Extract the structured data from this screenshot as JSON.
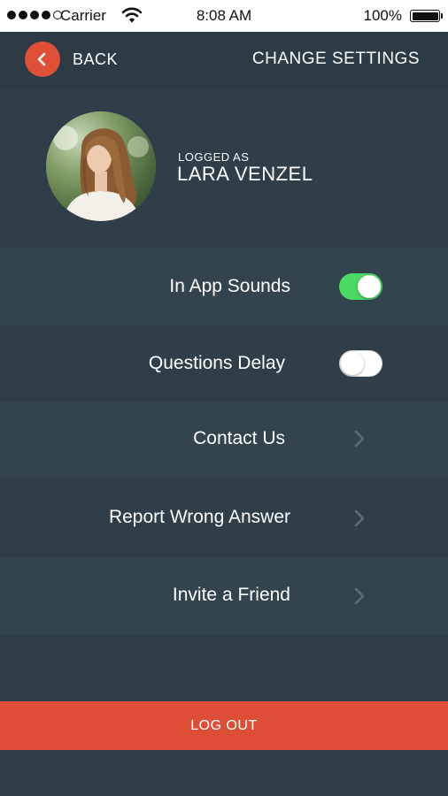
{
  "status_bar": {
    "carrier": "Carrier",
    "time": "8:08 AM",
    "battery": "100%",
    "signal_bars_filled": 4,
    "signal_bars_total": 5,
    "battery_level": 1.0
  },
  "header": {
    "back_label": "BACK",
    "title": "CHANGE SETTINGS",
    "back_icon": "chevron-left-icon"
  },
  "profile": {
    "logged_as_label": "LOGGED AS",
    "name": "LARA VENZEL"
  },
  "settings": {
    "in_app_sounds": {
      "label": "In App Sounds",
      "enabled": true
    },
    "questions_delay": {
      "label": "Questions Delay",
      "enabled": false
    },
    "contact_us": {
      "label": "Contact Us",
      "icon": "chevron-right-icon"
    },
    "report_wrong_answer": {
      "label": "Report Wrong Answer",
      "icon": "chevron-right-icon"
    },
    "invite_friend": {
      "label": "Invite a Friend",
      "icon": "chevron-right-icon"
    }
  },
  "logout": {
    "label": "LOG OUT"
  },
  "colors": {
    "background": "#2f3e49",
    "header": "#2c3b46",
    "row_alt": "#34444f",
    "accent": "#e05038",
    "toggle_on": "#4cd964",
    "chevron": "#5d6d78"
  }
}
